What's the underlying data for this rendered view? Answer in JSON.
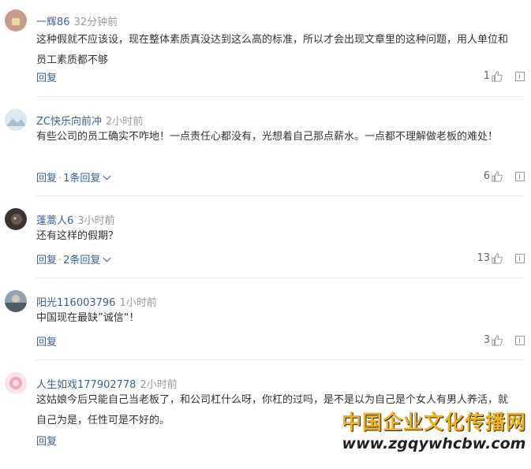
{
  "comments": [
    {
      "user": "一辉86",
      "time": "32分钟前",
      "text": "这种假就不应该设，现在整体素质真没达到这么高的标准，所以才会出现文章里的这种问题，用人单位和员工素质都不够",
      "reply": "回复",
      "replies_label": "",
      "likes": "1",
      "avatar_color": "#c79a8a"
    },
    {
      "user": "ZC快乐向前冲",
      "time": "2小时前",
      "text": "有些公司的员工确实不咋地！一点责任心都没有，光想着自己那点薪水。一点都不理解做老板的难处！",
      "reply": "回复",
      "replies_label": "1条回复",
      "likes": "6",
      "avatar_color": "#b9cbd9"
    },
    {
      "user": "蓬蒿人6",
      "time": "3小时前",
      "text": "还有这样的假期？",
      "reply": "回复",
      "replies_label": "2条回复",
      "likes": "13",
      "avatar_color": "#5a4a44"
    },
    {
      "user": "阳光116003796",
      "time": "1小时前",
      "text": "中国现在最缺”诚信“！",
      "reply": "回复",
      "replies_label": "",
      "likes": "3",
      "avatar_color": "#6d7f8c"
    },
    {
      "user": "人生如戏177902778",
      "time": "2小时前",
      "text": "这姑娘今后只能自己当老板了，和公司杠什么呀，你杠的过吗，是不是以为自己是个女人有男人养活，就自己为是，任性可是不好的。",
      "reply": "回复",
      "replies_label": "",
      "likes": "",
      "avatar_color": "#f3c7cf"
    }
  ],
  "watermark": {
    "line1": "中国企业文化传播网",
    "line2": "www.zgqywhcbw.com"
  },
  "icons": {
    "like": "thumbs-up-icon",
    "report": "report-icon",
    "expand": "chevron-down-icon"
  }
}
